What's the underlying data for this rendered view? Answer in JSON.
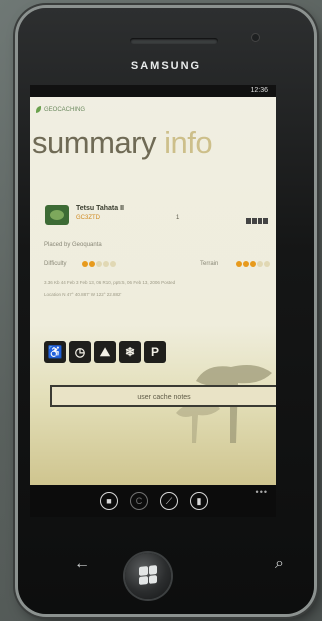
{
  "device": {
    "brand": "SAMSUNG"
  },
  "status": {
    "time": "12:36"
  },
  "app": {
    "name": "GEOCACHING",
    "title_main": "summary",
    "title_sub": "info"
  },
  "cache": {
    "name": "Tetsu Tahata II",
    "code": "GC3ZTD",
    "favorites": "1",
    "placed_by": "Placed by Geoquanta",
    "difficulty_label": "Difficulty",
    "difficulty": 2,
    "terrain_label": "Terrain",
    "terrain": 2.5,
    "hidden_line": "3.36 Kb 44 Feb 3 Feb 13, 06 R10, pp5:5, 06 Feb 13, 2006 Posted",
    "location_line": "Location N 47° 40.887' W 122° 22.882'"
  },
  "attributes": [
    {
      "icon": "wheelchair-icon",
      "glyph": "♿"
    },
    {
      "icon": "clock-icon",
      "glyph": "◷"
    },
    {
      "icon": "hiking-icon",
      "glyph": "⛰"
    },
    {
      "icon": "snowflake-icon",
      "glyph": "❄"
    },
    {
      "icon": "parking-icon",
      "glyph": "P"
    }
  ],
  "buttons": {
    "user_notes": "user cache notes"
  },
  "appbar": {
    "more": "•••"
  },
  "colors": {
    "accent": "#e79a1d",
    "title": "#6f6a55",
    "subtitle": "#cdbf8a"
  }
}
